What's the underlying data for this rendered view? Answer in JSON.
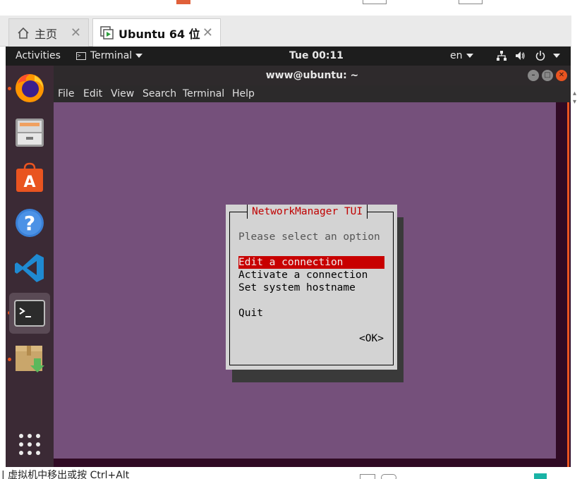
{
  "vmware": {
    "tabs": [
      {
        "label": "主页",
        "icon": "home-icon"
      },
      {
        "label": "Ubuntu 64 位",
        "icon": "vm-play-icon"
      }
    ],
    "close_glyph": "✕",
    "status_text": "| 虚拟机中移出或按 Ctrl+Alt"
  },
  "panel": {
    "activities": "Activities",
    "app_menu": "Terminal",
    "clock": "Tue 00:11",
    "lang": "en"
  },
  "dock": {
    "apps": [
      "firefox-icon",
      "files-icon",
      "software-center-icon",
      "help-icon",
      "vscode-icon",
      "terminal-icon",
      "archive-manager-icon",
      "show-apps-icon"
    ]
  },
  "terminal": {
    "title": "www@ubuntu: ~",
    "menu": [
      "File",
      "Edit",
      "View",
      "Search",
      "Terminal",
      "Help"
    ]
  },
  "nmtui": {
    "title": "NetworkManager TUI",
    "prompt": "Please select an option",
    "options": [
      "Edit a connection",
      "Activate a connection",
      "Set system hostname"
    ],
    "selected_option": "Edit a connection",
    "quit": "Quit",
    "ok": "<OK>"
  },
  "colors": {
    "ubuntu_orange": "#e95420",
    "terminal_bg": "#75507b",
    "dialog_bg": "#d3d3d3",
    "selection_red": "#c80000"
  }
}
